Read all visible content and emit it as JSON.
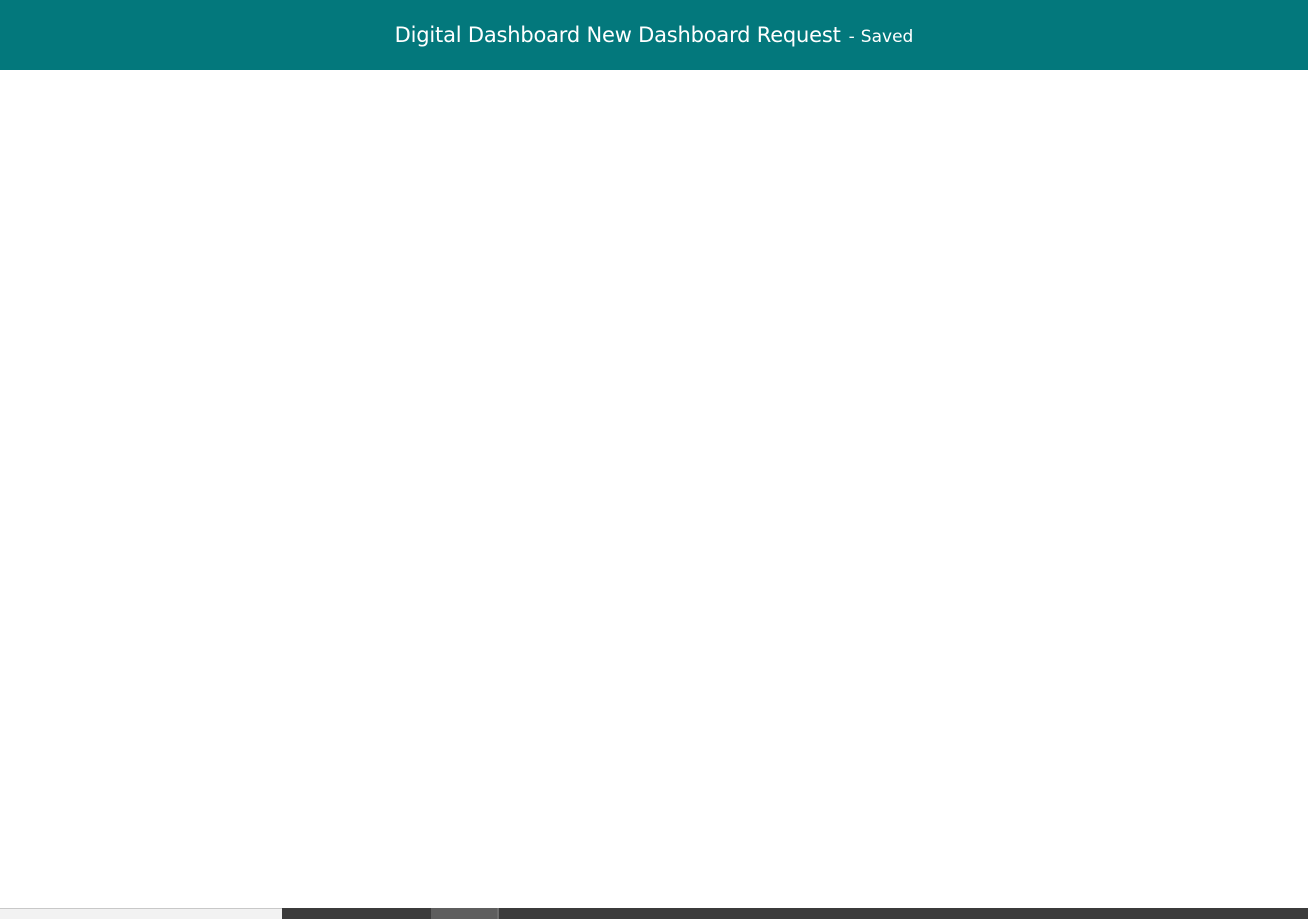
{
  "header": {
    "title": "Digital Dashboard New Dashboard Request",
    "separator": "-",
    "status": "Saved",
    "background_color": "#03787c"
  }
}
